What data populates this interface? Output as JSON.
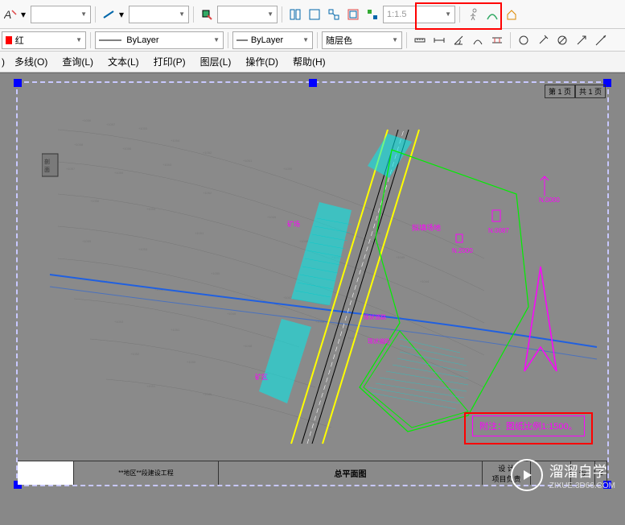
{
  "toolbar1": {
    "scale_value": "1:1.5"
  },
  "toolbar2": {
    "color_label": "红",
    "linetype1": "ByLayer",
    "linetype2": "ByLayer",
    "color2": "随层色"
  },
  "menu": {
    "items": [
      {
        "label": "多线(O)",
        "key": "O"
      },
      {
        "label": "查询(L)",
        "key": "L"
      },
      {
        "label": "文本(L)",
        "key": "L"
      },
      {
        "label": "打印(P)",
        "key": "P"
      },
      {
        "label": "图层(L)",
        "key": "L"
      },
      {
        "label": "操作(D)",
        "key": "D"
      },
      {
        "label": "帮助(H)",
        "key": "H"
      }
    ]
  },
  "drawing": {
    "page_info_1": "第 1 页",
    "page_info_2": "共 1 页",
    "annotation": "附注：图纸比例1:1500。",
    "titleblock": {
      "title": "总平面图",
      "design": "设 计",
      "project": "项目负责"
    },
    "labels": {
      "area1": "拟填场地",
      "north_val1": "N.0000",
      "north_val2": "N.2000",
      "north_val3": "N.0087"
    }
  },
  "watermark": {
    "brand": "溜溜自学",
    "url": "ZIXUE.3D66.COM"
  }
}
